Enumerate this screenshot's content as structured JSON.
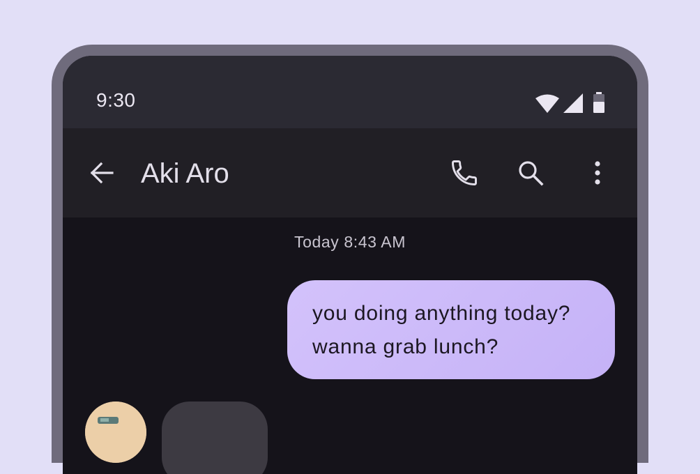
{
  "status_bar": {
    "time": "9:30",
    "icons": [
      "wifi-icon",
      "cellular-signal-icon",
      "battery-icon"
    ]
  },
  "app_bar": {
    "back_icon": "arrow-back-icon",
    "contact_name": "Aki Aro",
    "actions": [
      "phone-icon",
      "search-icon",
      "more-vert-icon"
    ]
  },
  "conversation": {
    "timestamp": "Today 8:43 AM",
    "messages": [
      {
        "direction": "outgoing",
        "lines": [
          "you doing anything today?",
          "wanna grab lunch?"
        ]
      },
      {
        "direction": "incoming",
        "avatar": "contact-avatar",
        "text": ""
      }
    ]
  },
  "colors": {
    "background": "#e2dff7",
    "device_frame": "#6f6b7c",
    "status_bar": "#2b2a33",
    "app_bar": "#211f25",
    "screen": "#15131a",
    "outgoing_bubble": "#cbb9fa",
    "incoming_bubble": "#3d3a42",
    "avatar": "#eccfa8"
  }
}
